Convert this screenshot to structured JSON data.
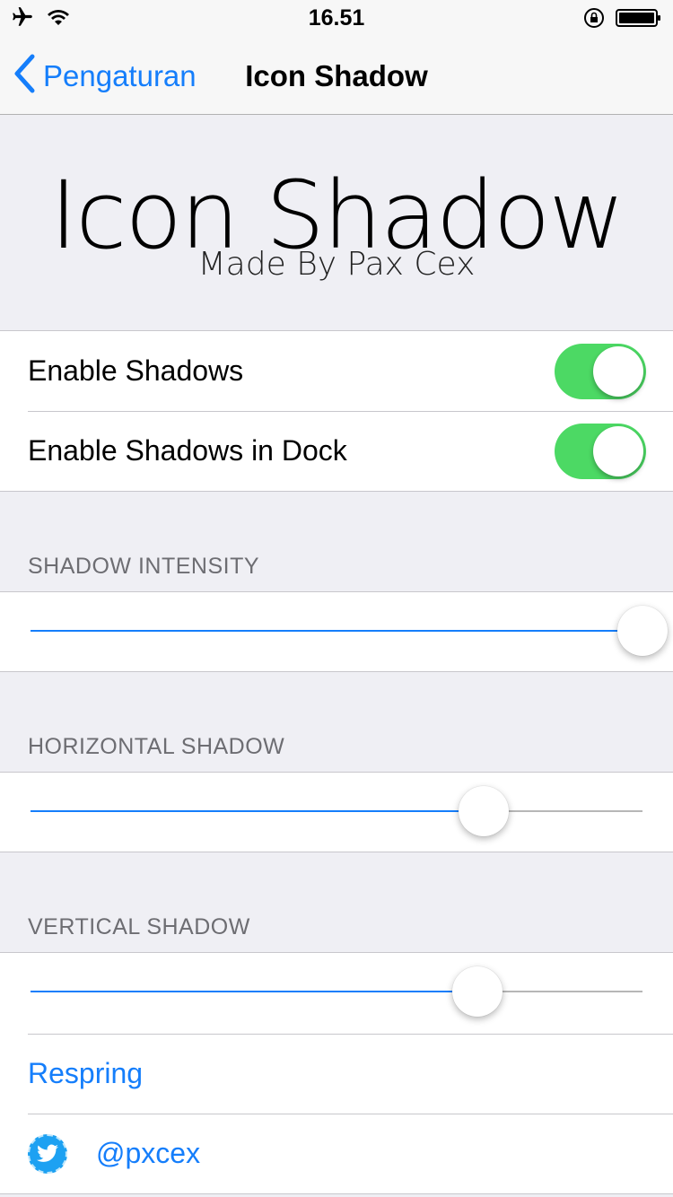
{
  "status": {
    "time": "16.51",
    "icons": [
      "airplane-icon",
      "wifi-icon",
      "rotation-lock-icon",
      "battery-icon"
    ]
  },
  "nav": {
    "back_label": "Pengaturan",
    "title": "Icon Shadow"
  },
  "banner": {
    "title": "Icon Shadow",
    "subtitle": "Made By Pax Cex"
  },
  "toggles": [
    {
      "label": "Enable Shadows",
      "on": true
    },
    {
      "label": "Enable Shadows in Dock",
      "on": true
    }
  ],
  "sliders": [
    {
      "header": "SHADOW INTENSITY",
      "value": 1.0
    },
    {
      "header": "HORIZONTAL SHADOW",
      "value": 0.74
    },
    {
      "header": "VERTICAL SHADOW",
      "value": 0.73
    }
  ],
  "links": {
    "respring": "Respring",
    "twitter": "@pxcex"
  },
  "colors": {
    "accent": "#157efb",
    "switch_on": "#4cd964",
    "background": "#efeff4"
  }
}
